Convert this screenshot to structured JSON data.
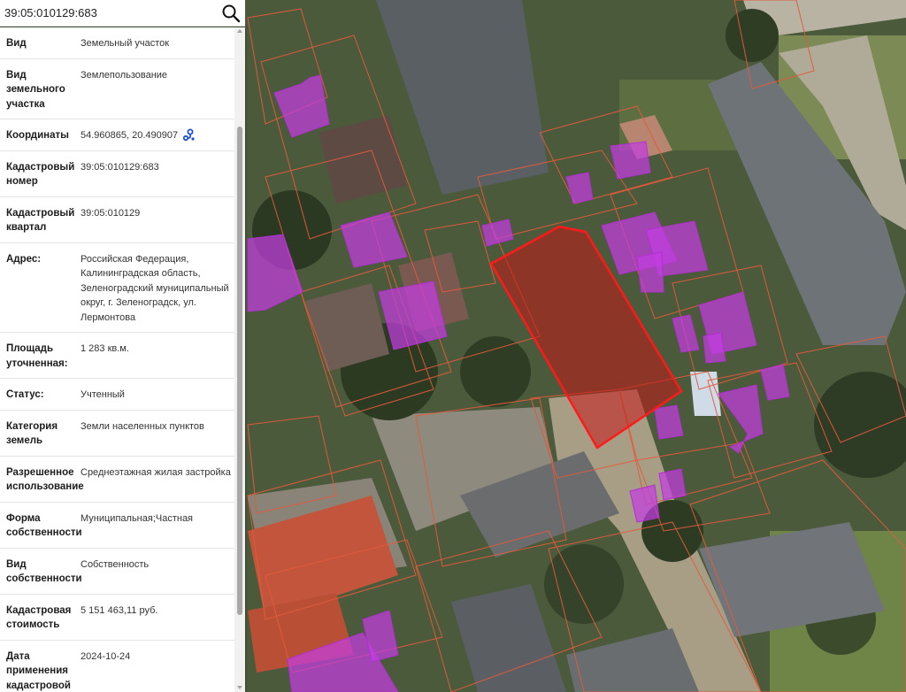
{
  "search": {
    "value": "39:05:010129:683",
    "placeholder": ""
  },
  "icons": {
    "search": "search-icon",
    "locate": "map-location-icon"
  },
  "colors": {
    "selected_parcel": "#ff1a1a",
    "parcel_borders": "#e25b3c",
    "building_overlay": "#c33de0",
    "link_icon": "#1d4fd8"
  },
  "info": {
    "rows": [
      {
        "label": "Вид",
        "value": "Земельный участок"
      },
      {
        "label": "Вид земельного участка",
        "value": "Землепользование"
      },
      {
        "label": "Координаты",
        "value": "54.960865, 20.490907"
      },
      {
        "label": "Кадастровый номер",
        "value": "39:05:010129:683"
      },
      {
        "label": "Кадастровый квартал",
        "value": "39:05:010129"
      },
      {
        "label": "Адрес:",
        "value": "Российская Федерация, Калининградская область, Зеленоградский муниципальный округ, г. Зеленоградск, ул. Лермонтова"
      },
      {
        "label": "Площадь уточненная:",
        "value": "1 283 кв.м."
      },
      {
        "label": "Статус:",
        "value": "Учтенный"
      },
      {
        "label": "Категория земель",
        "value": "Земли населенных пунктов"
      },
      {
        "label": "Разрешенное использование",
        "value": "Среднеэтажная жилая застройка"
      },
      {
        "label": "Форма собственности",
        "value": "Муниципальная;Частная"
      },
      {
        "label": "Вид собственности",
        "value": "Собственность"
      },
      {
        "label": "Кадастровая стоимость",
        "value": "5 151 463,11 руб."
      },
      {
        "label": "Дата применения кадастровой стоимости",
        "value": "2024-10-24"
      }
    ]
  }
}
